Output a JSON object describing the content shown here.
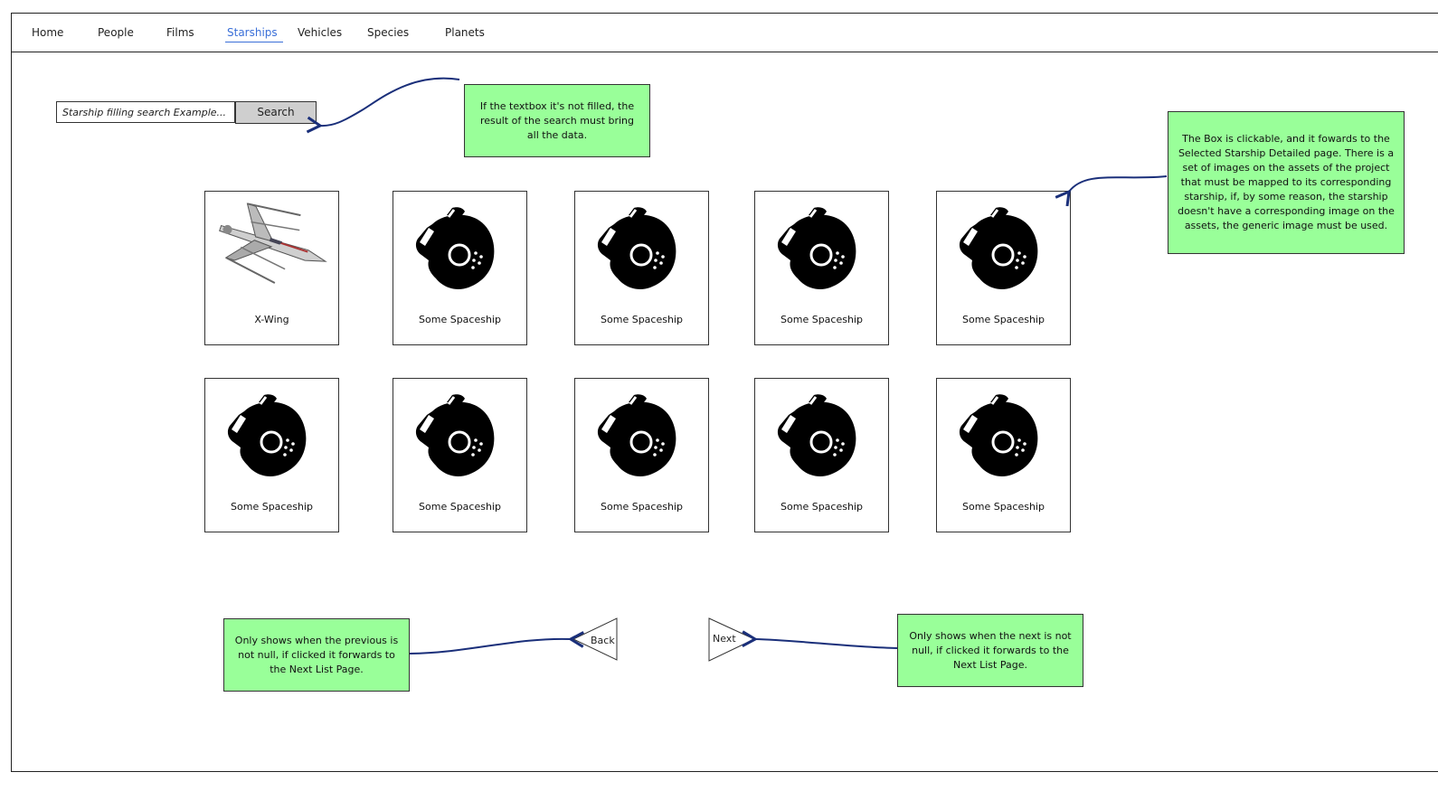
{
  "nav": {
    "items": [
      {
        "label": "Home"
      },
      {
        "label": "People"
      },
      {
        "label": "Films"
      },
      {
        "label": "Starships"
      },
      {
        "label": "Vehicles"
      },
      {
        "label": "Species"
      },
      {
        "label": "Planets"
      }
    ],
    "active": "Starships",
    "accent_color": "#3a6fd8"
  },
  "search": {
    "placeholder": "Starship filling search Example...",
    "value": "",
    "button_label": "Search"
  },
  "notes": {
    "search_note": "If the textbox it's not filled, the result of the search must bring all the data.",
    "card_note": "The Box is clickable, and it fowards to the Selected Starship Detailed page. There is a set of images on the assets of the project that must be mapped to its corresponding starship, if, by some reason, the starship doesn't have a corresponding image on the assets, the generic image must be used.",
    "back_note": "Only shows when the previous is not null, if clicked it forwards to the Next List Page.",
    "next_note": "Only shows when the next is not null, if clicked it forwards to the Next List Page.",
    "note_color": "#99ff99"
  },
  "starships": [
    {
      "name": "X-Wing",
      "icon": "x-wing-image"
    },
    {
      "name": "Some Spaceship",
      "icon": "generic-starship-icon"
    },
    {
      "name": "Some Spaceship",
      "icon": "generic-starship-icon"
    },
    {
      "name": "Some Spaceship",
      "icon": "generic-starship-icon"
    },
    {
      "name": "Some Spaceship",
      "icon": "generic-starship-icon"
    },
    {
      "name": "Some Spaceship",
      "icon": "generic-starship-icon"
    },
    {
      "name": "Some Spaceship",
      "icon": "generic-starship-icon"
    },
    {
      "name": "Some Spaceship",
      "icon": "generic-starship-icon"
    },
    {
      "name": "Some Spaceship",
      "icon": "generic-starship-icon"
    },
    {
      "name": "Some Spaceship",
      "icon": "generic-starship-icon"
    }
  ],
  "pagination": {
    "back_label": "Back",
    "next_label": "Next"
  },
  "arrow_color": "#1a2f7a"
}
